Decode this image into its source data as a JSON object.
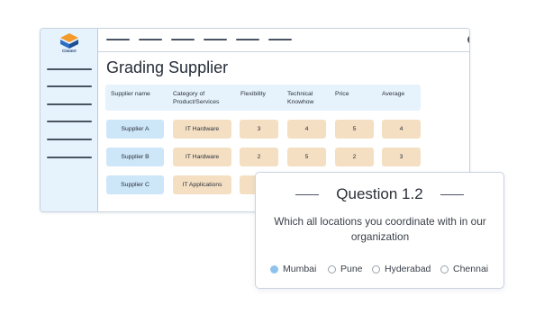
{
  "app": {
    "logo_text": "Cimmrr"
  },
  "page": {
    "title": "Grading Supplier"
  },
  "table": {
    "headers": {
      "supplier": "Supplier name",
      "category": "Category of Product/Services",
      "flexibility": "Flexibility",
      "technical": "Technical Knowhow",
      "price": "Price",
      "average": "Average"
    },
    "rows": [
      {
        "name": "Supplier A",
        "category": "IT Hardware",
        "flexibility": "3",
        "technical": "4",
        "price": "5",
        "average": "4"
      },
      {
        "name": "Supplier B",
        "category": "IT Hardware",
        "flexibility": "2",
        "technical": "5",
        "price": "2",
        "average": "3"
      },
      {
        "name": "Supplier C",
        "category": "IT Applications"
      }
    ]
  },
  "question": {
    "title": "Question 1.2",
    "text": "Which all locations you coordinate with in our organization",
    "options": [
      "Mumbai",
      "Pune",
      "Hyderabad",
      "Chennai"
    ],
    "selected": "Mumbai"
  },
  "colors": {
    "sidebar_bg": "#e6f3fc",
    "header_bg": "#e6f3fc",
    "name_cell": "#cde6f8",
    "value_cell": "#f4dfc3",
    "selected_radio": "#8fc3ee"
  }
}
